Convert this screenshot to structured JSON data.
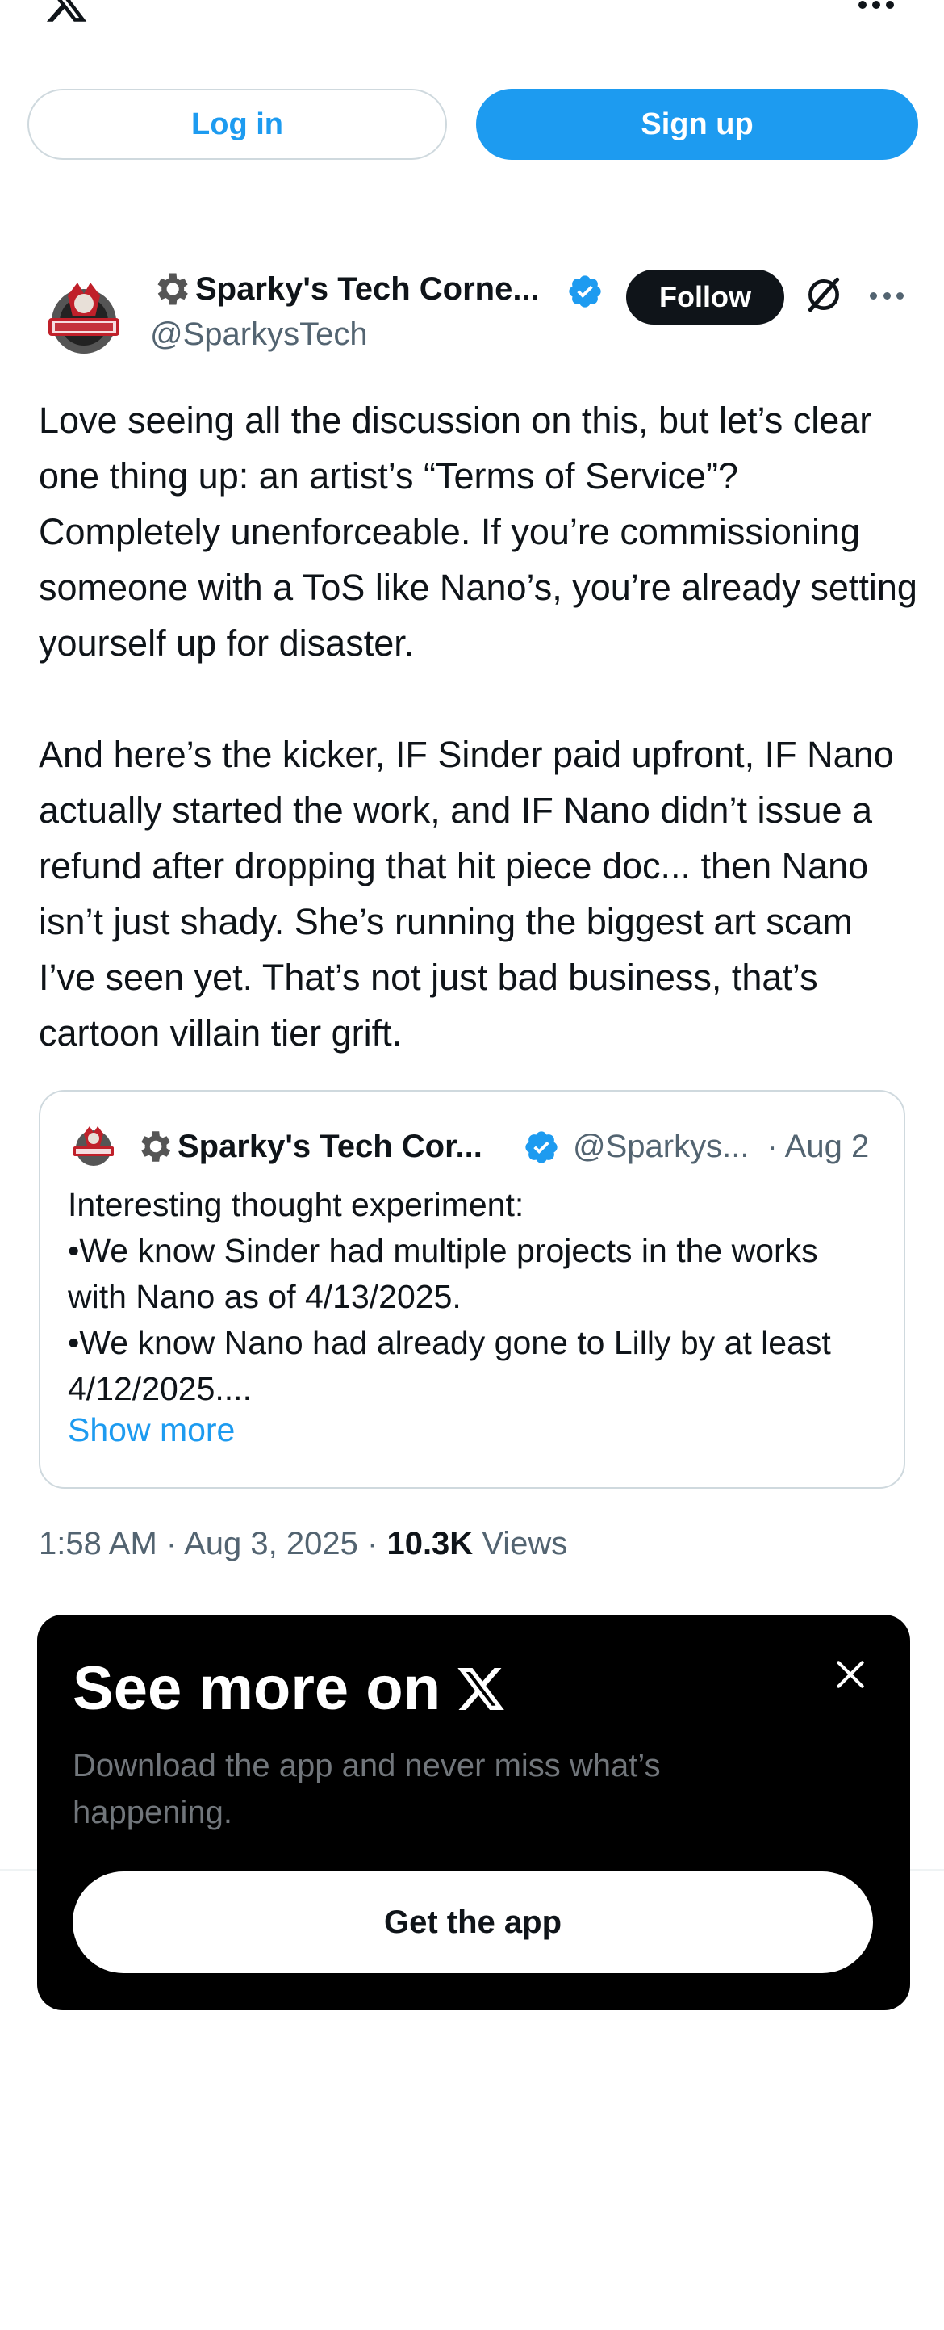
{
  "header": {
    "logo_icon": "x-logo-icon",
    "more_icon": "more-dots-icon",
    "login_label": "Log in",
    "signup_label": "Sign up"
  },
  "tweet": {
    "display_name": "Sparky's Tech Corne...",
    "handle": "@SparkysTech",
    "follow_label": "Follow",
    "paragraphs": [
      "Love seeing all the discussion on this, but let’s clear one thing up: an artist’s “Terms of Service”? Completely unenforceable. If you’re commissioning someone with a ToS like Nano’s, you’re already setting yourself up for disaster.",
      "And here’s the kicker, IF Sinder paid upfront, IF Nano actually started the work, and IF Nano didn’t issue a refund after dropping that hit piece doc... then Nano isn’t just shady. She’s running the biggest art scam I’ve seen yet. That’s not just bad business, that’s cartoon villain tier grift."
    ],
    "time": "1:58 AM",
    "date": "Aug 3, 2025",
    "views_count": "10.3K",
    "views_label": "Views",
    "separator": "·"
  },
  "quote": {
    "display_name": "Sparky's Tech Cor...",
    "handle": "@Sparkys...",
    "date": "· Aug 2",
    "lines": [
      "Interesting thought experiment:",
      "•We know Sinder had multiple projects in the works with Nano as of 4/13/2025.",
      "•We know Nano had already gone to Lilly by at least 4/12/2025...."
    ],
    "show_more": "Show more"
  },
  "popup": {
    "title": "See more on",
    "subtitle": "Download the app and never miss what’s happening.",
    "cta": "Get the app",
    "close_icon": "close-icon"
  },
  "colors": {
    "accent": "#1d9bf0",
    "text": "#0f1419",
    "muted": "#536471",
    "popup_bg": "#000000",
    "avatar_red": "#c0202a"
  }
}
